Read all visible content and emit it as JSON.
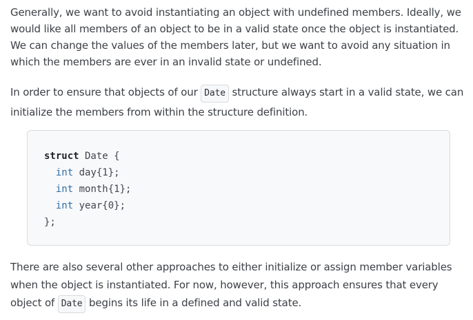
{
  "paragraph1": "Generally, we want to avoid instantiating an object with undefined members. Ideally, we would like all members of an object to be in a valid state once the object is instantiated. We can change the values of the members later, but we want to avoid any situation in which the members are ever in an invalid state or undefined.",
  "paragraph2": {
    "before": "In order to ensure that objects of our ",
    "code": "Date",
    "after": " structure always start in a valid state, we can initialize the members from within the structure definition."
  },
  "code_block": {
    "line1_keyword": "struct",
    "line1_name": " Date {",
    "line2_type": "int",
    "line2_rest": " day{1};",
    "line3_type": "int",
    "line3_rest": " month{1};",
    "line4_type": "int",
    "line4_rest": " year{0};",
    "line5": "};"
  },
  "paragraph3": {
    "before": "There are also several other approaches to either initialize or assign member variables when the object is instantiated. For now, however, this approach ensures that every object of ",
    "code": "Date",
    "after": " begins its life in a defined and valid state."
  }
}
